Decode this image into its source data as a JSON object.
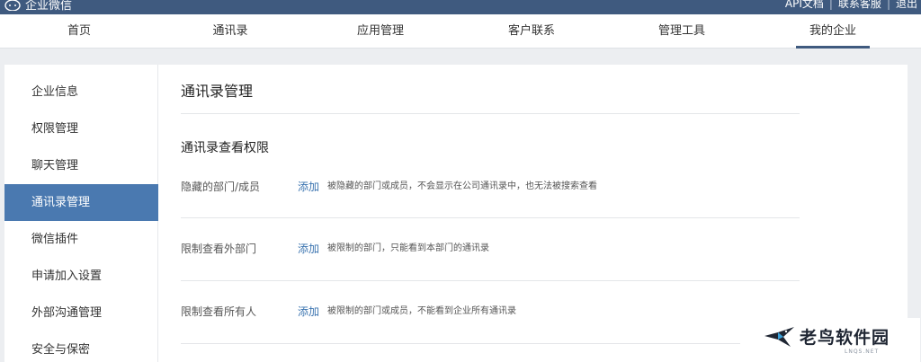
{
  "app": {
    "title": "企业微信",
    "top_links": [
      "API文档",
      "联系客服",
      "退出"
    ]
  },
  "nav": {
    "items": [
      "首页",
      "通讯录",
      "应用管理",
      "客户联系",
      "管理工具",
      "我的企业"
    ],
    "active": "我的企业"
  },
  "sidebar": {
    "items": [
      "企业信息",
      "权限管理",
      "聊天管理",
      "通讯录管理",
      "微信插件",
      "申请加入设置",
      "外部沟通管理",
      "安全与保密"
    ],
    "active": "通讯录管理"
  },
  "main": {
    "title": "通讯录管理",
    "section_title": "通讯录查看权限",
    "rows": [
      {
        "label": "隐藏的部门/成员",
        "action": "添加",
        "desc": "被隐藏的部门或成员，不会显示在公司通讯录中，也无法被搜索查看"
      },
      {
        "label": "限制查看外部门",
        "action": "添加",
        "desc": "被限制的部门，只能看到本部门的通讯录"
      },
      {
        "label": "限制查看所有人",
        "action": "添加",
        "desc": "被限制的部门或成员，不能看到企业所有通讯录"
      }
    ]
  },
  "watermark": {
    "text": "老鸟软件园",
    "sub": "LNQS.NET"
  },
  "colors": {
    "header_bg": "#3f5a7f",
    "accent": "#4a79b0",
    "link": "#3b74b0"
  }
}
